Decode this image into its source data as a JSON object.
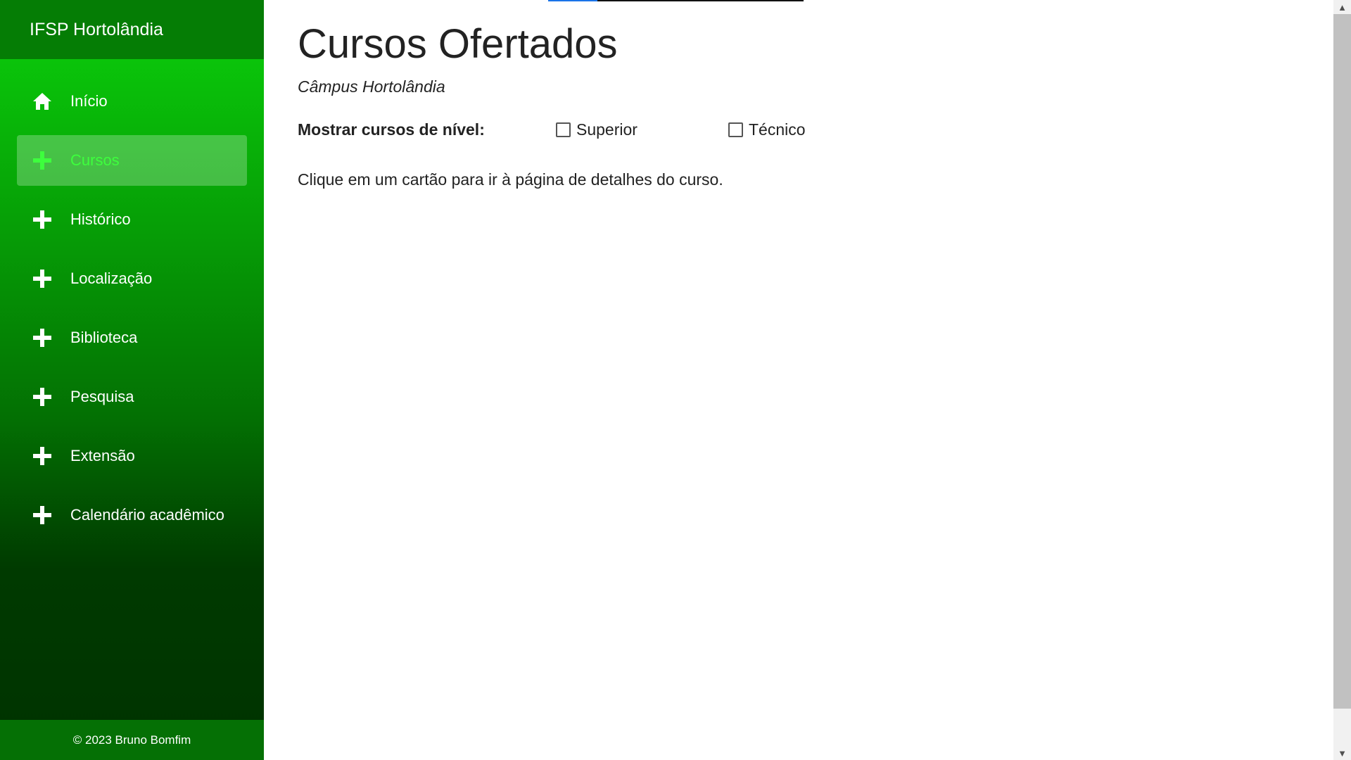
{
  "sidebar": {
    "brand": "IFSP Hortolândia",
    "items": [
      {
        "label": "Início",
        "icon": "home-icon",
        "active": false
      },
      {
        "label": "Cursos",
        "icon": "plus-icon",
        "active": true
      },
      {
        "label": "Histórico",
        "icon": "plus-icon",
        "active": false
      },
      {
        "label": "Localização",
        "icon": "plus-icon",
        "active": false
      },
      {
        "label": "Biblioteca",
        "icon": "plus-icon",
        "active": false
      },
      {
        "label": "Pesquisa",
        "icon": "plus-icon",
        "active": false
      },
      {
        "label": "Extensão",
        "icon": "plus-icon",
        "active": false
      },
      {
        "label": "Calendário acadêmico",
        "icon": "plus-icon",
        "active": false
      }
    ],
    "footer": "© 2023 Bruno Bomfim"
  },
  "main": {
    "title": "Cursos Ofertados",
    "subtitle": "Câmpus Hortolândia",
    "filter": {
      "label": "Mostrar cursos de nível:",
      "options": [
        {
          "label": "Superior",
          "checked": false
        },
        {
          "label": "Técnico",
          "checked": false
        }
      ]
    },
    "hint": "Clique em um cartão para ir à página de detalhes do curso."
  },
  "colors": {
    "sidebar_top": "#0bd10b",
    "sidebar_bottom": "#003300",
    "active_text": "#3dff3d",
    "loading_accent": "#1a73e8"
  }
}
